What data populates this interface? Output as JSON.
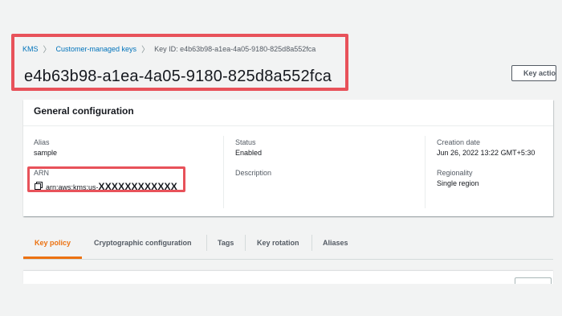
{
  "breadcrumb": {
    "kms": "KMS",
    "customer_managed_keys": "Customer-managed keys",
    "current": "Key ID: e4b63b98-a1ea-4a05-9180-825d8a552fca",
    "separator": "〉"
  },
  "page_title": "e4b63b98-a1ea-4a05-9180-825d8a552fca",
  "key_actions_label": "Key actions",
  "general_configuration": {
    "title": "General configuration",
    "alias_label": "Alias",
    "alias_value": "sample",
    "arn_label": "ARN",
    "arn_prefix": "arn:aws:kms:us-",
    "arn_masked": "XXXXXXXXXXXX",
    "status_label": "Status",
    "status_value": "Enabled",
    "description_label": "Description",
    "creation_date_label": "Creation date",
    "creation_date_value": "Jun 26, 2022 13:22 GMT+5:30",
    "regionality_label": "Regionality",
    "regionality_value": "Single region"
  },
  "tabs": [
    {
      "label": "Key policy",
      "active": true
    },
    {
      "label": "Cryptographic configuration",
      "active": false
    },
    {
      "label": "Tags",
      "active": false
    },
    {
      "label": "Key rotation",
      "active": false
    },
    {
      "label": "Aliases",
      "active": false
    }
  ],
  "colors": {
    "annotation_red": "#e8525a",
    "link_blue": "#0073bb",
    "active_tab_orange": "#ec7211"
  },
  "icons": {
    "copy": "copy-icon",
    "breadcrumb_separator": "chevron-right-icon"
  }
}
